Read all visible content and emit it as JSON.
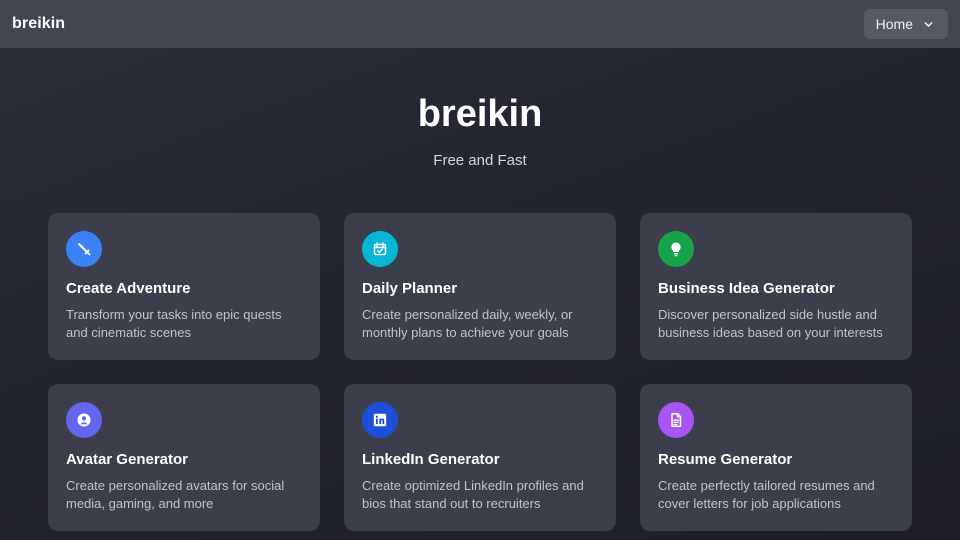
{
  "navbar": {
    "brand": "breikin",
    "menu_selected": "Home"
  },
  "hero": {
    "title": "breikin",
    "subtitle": "Free and Fast"
  },
  "cards": [
    {
      "title": "Create Adventure",
      "description": "Transform your tasks into epic quests and cinematic scenes",
      "icon": "sword-icon",
      "color": "#3b82f6"
    },
    {
      "title": "Daily Planner",
      "description": "Create personalized daily, weekly, or monthly plans to achieve your goals",
      "icon": "calendar-check-icon",
      "color": "#06b6d4"
    },
    {
      "title": "Business Idea Generator",
      "description": "Discover personalized side hustle and business ideas based on your interests",
      "icon": "lightbulb-icon",
      "color": "#16a34a"
    },
    {
      "title": "Avatar Generator",
      "description": "Create personalized avatars for social media, gaming, and more",
      "icon": "user-circle-icon",
      "color": "#6366f1"
    },
    {
      "title": "LinkedIn Generator",
      "description": "Create optimized LinkedIn profiles and bios that stand out to recruiters",
      "icon": "linkedin-icon",
      "color": "#1d4ed8"
    },
    {
      "title": "Resume Generator",
      "description": "Create perfectly tailored resumes and cover letters for job applications",
      "icon": "document-icon",
      "color": "#a855f7"
    }
  ]
}
